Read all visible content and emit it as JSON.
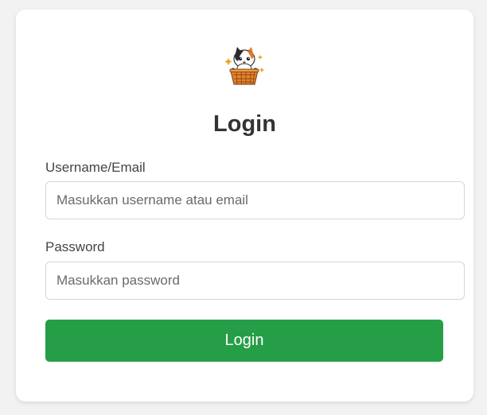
{
  "colors": {
    "background": "#f2f2f2",
    "card": "#ffffff",
    "button": "#269e47",
    "button_text": "#ffffff",
    "heading": "#333333"
  },
  "logo": {
    "icon": "cat-in-basket-icon"
  },
  "form": {
    "title": "Login",
    "username": {
      "label": "Username/Email",
      "value": "",
      "placeholder": "Masukkan username atau email"
    },
    "password": {
      "label": "Password",
      "value": "",
      "placeholder": "Masukkan password"
    },
    "submit_label": "Login"
  }
}
